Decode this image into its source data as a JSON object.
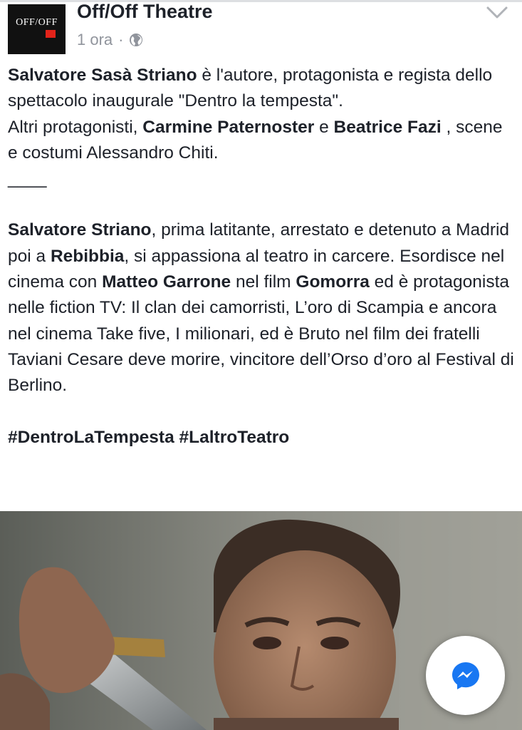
{
  "post": {
    "page_name": "Off/Off Theatre",
    "avatar_logo_text": "OFF/OFF",
    "time": "1 ora",
    "dot": "·",
    "privacy_icon": "globe-icon",
    "menu_icon": "chevron-down-icon",
    "paragraph1": {
      "name1": "Salvatore Sasà Striano",
      "text1": " è l'autore, protagonista e regista dello spettacolo inaugurale \"Dentro la tempesta\".",
      "text2": "Altri protagonisti, ",
      "name2": "Carmine Paternoster",
      "text3": " e ",
      "name3": "Beatrice Fazi",
      "text4": " , scene e costumi Alessandro Chiti."
    },
    "separator": "____",
    "paragraph2": {
      "name1": "Salvatore Striano",
      "text1": ", prima latitante, arrestato e detenuto a Madrid poi a ",
      "name2": "Rebibbia",
      "text2": ", si appassiona al teatro in carcere. Esordisce nel cinema con ",
      "name3": "Matteo Garrone",
      "text3": " nel film ",
      "name4": "Gomorra",
      "text4": " ed è protagonista nelle fiction TV: Il clan dei camorristi, L’oro di Scampia e ancora nel cinema Take five, I milionari, ed è Bruto nel film dei fratelli Taviani Cesare deve morire, vincitore dell’Orso d’oro al Festival di Berlino."
    },
    "hashtags": "#DentroLaTempesta #LaltroTeatro",
    "photo_icon": "actor-photo",
    "fab_icon": "messenger-icon"
  },
  "colors": {
    "text": "#1d2129",
    "meta": "#90949c",
    "messenger_blue": "#1877f2",
    "logo_red": "#e2231a"
  }
}
